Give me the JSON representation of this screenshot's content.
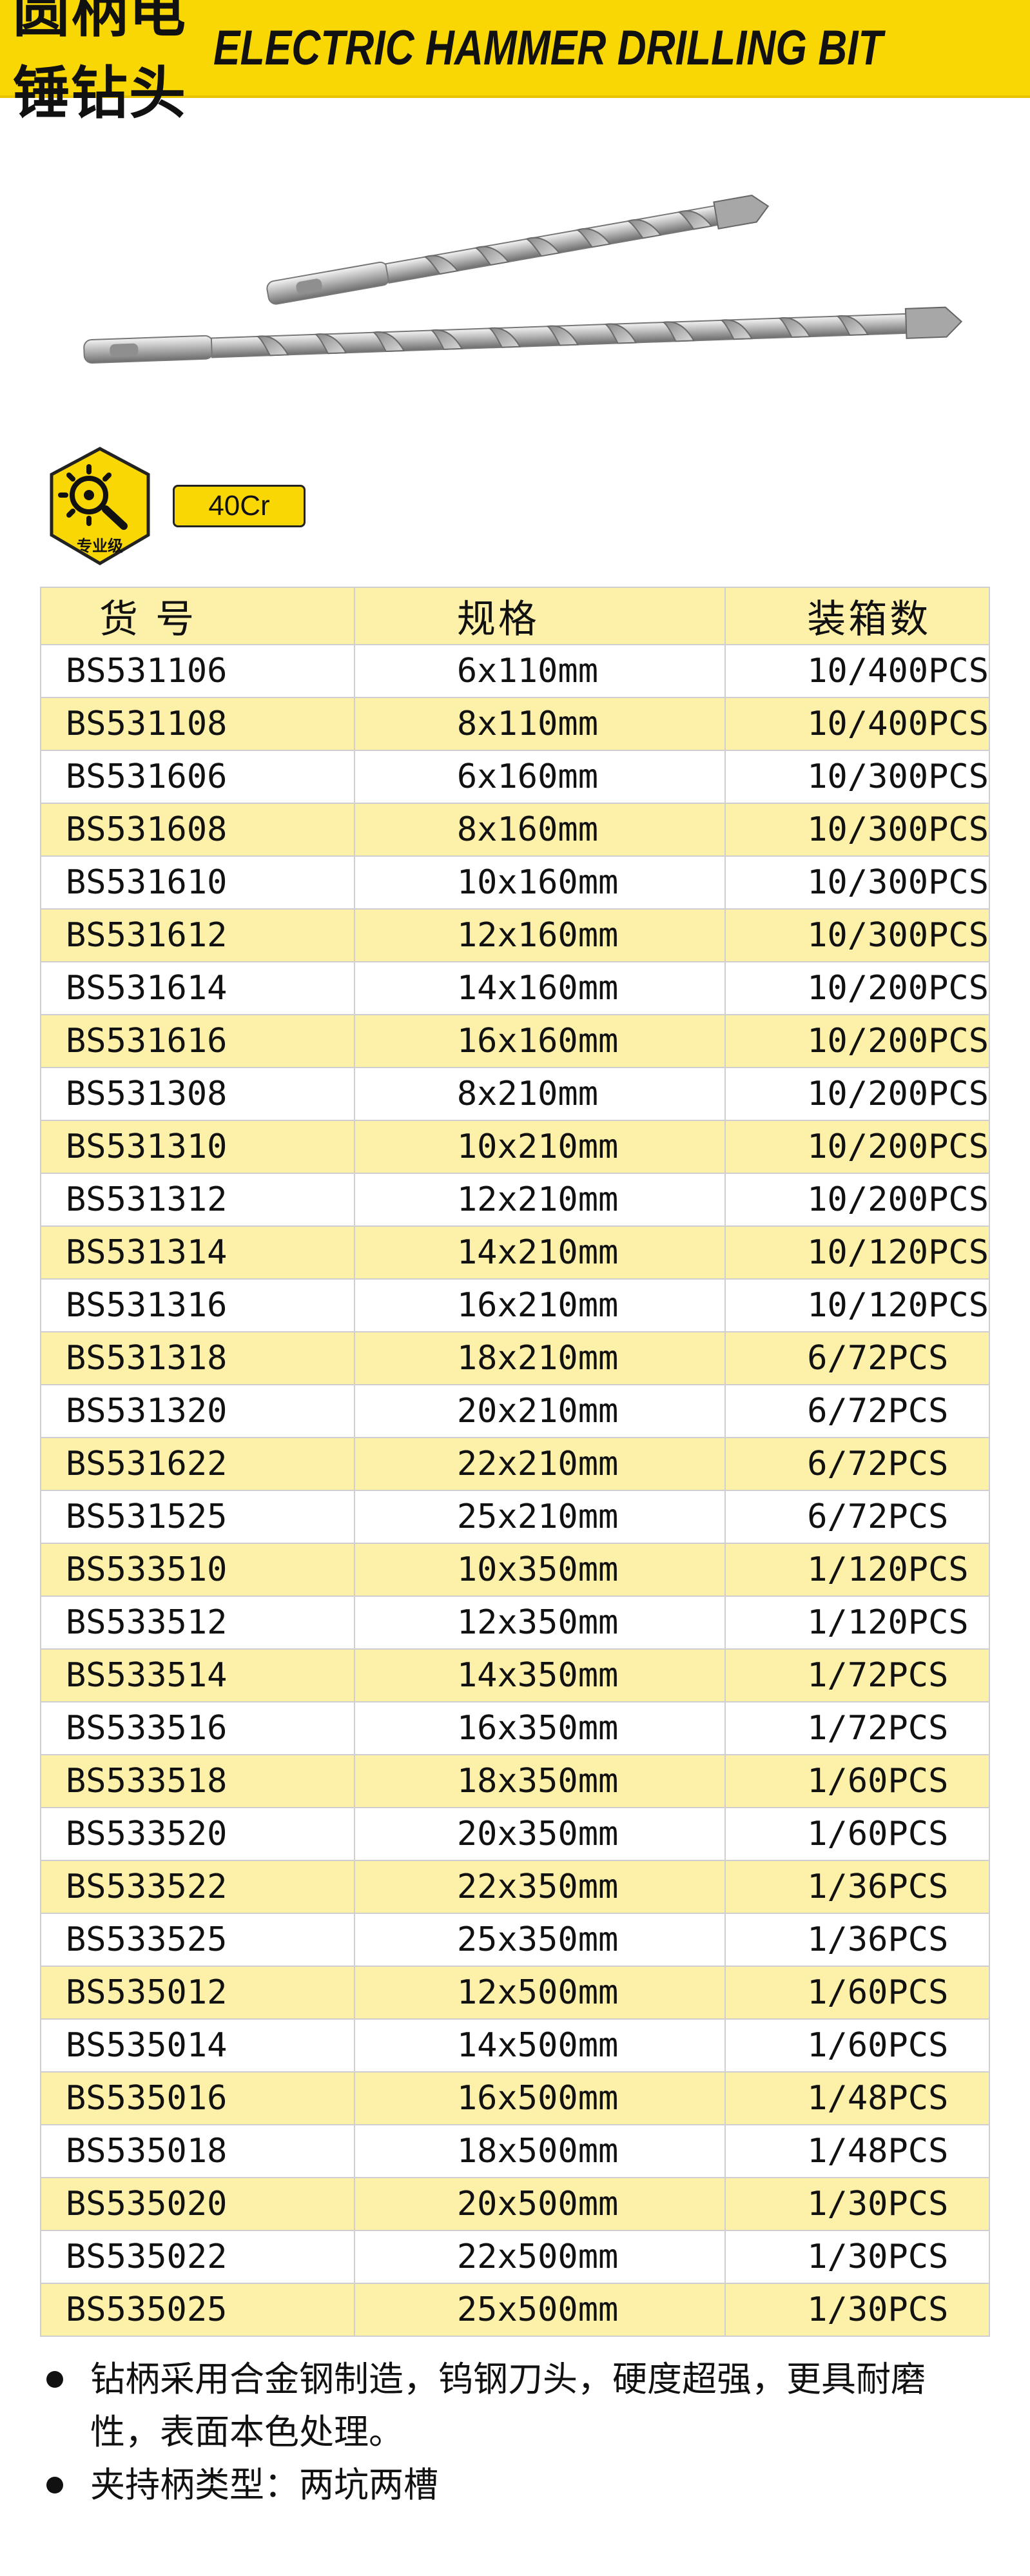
{
  "header": {
    "title_cn": "圆柄电锤钻头",
    "title_en": "ELECTRIC HAMMER DRILLING BIT"
  },
  "badge": {
    "label": "专业级",
    "icon": "professional-grade-icon"
  },
  "material": "40Cr",
  "table": {
    "headers": [
      "货 号",
      "规格",
      "装箱数"
    ],
    "rows": [
      [
        "BS531106",
        "6x110mm",
        "10/400PCS"
      ],
      [
        "BS531108",
        "8x110mm",
        "10/400PCS"
      ],
      [
        "BS531606",
        "6x160mm",
        "10/300PCS"
      ],
      [
        "BS531608",
        "8x160mm",
        "10/300PCS"
      ],
      [
        "BS531610",
        "10x160mm",
        "10/300PCS"
      ],
      [
        "BS531612",
        "12x160mm",
        "10/300PCS"
      ],
      [
        "BS531614",
        "14x160mm",
        "10/200PCS"
      ],
      [
        "BS531616",
        "16x160mm",
        "10/200PCS"
      ],
      [
        "BS531308",
        "8x210mm",
        "10/200PCS"
      ],
      [
        "BS531310",
        "10x210mm",
        "10/200PCS"
      ],
      [
        "BS531312",
        "12x210mm",
        "10/200PCS"
      ],
      [
        "BS531314",
        "14x210mm",
        "10/120PCS"
      ],
      [
        "BS531316",
        "16x210mm",
        "10/120PCS"
      ],
      [
        "BS531318",
        "18x210mm",
        "6/72PCS"
      ],
      [
        "BS531320",
        "20x210mm",
        "6/72PCS"
      ],
      [
        "BS531622",
        "22x210mm",
        "6/72PCS"
      ],
      [
        "BS531525",
        "25x210mm",
        "6/72PCS"
      ],
      [
        "BS533510",
        "10x350mm",
        "1/120PCS"
      ],
      [
        "BS533512",
        "12x350mm",
        "1/120PCS"
      ],
      [
        "BS533514",
        "14x350mm",
        "1/72PCS"
      ],
      [
        "BS533516",
        "16x350mm",
        "1/72PCS"
      ],
      [
        "BS533518",
        "18x350mm",
        "1/60PCS"
      ],
      [
        "BS533520",
        "20x350mm",
        "1/60PCS"
      ],
      [
        "BS533522",
        "22x350mm",
        "1/36PCS"
      ],
      [
        "BS533525",
        "25x350mm",
        "1/36PCS"
      ],
      [
        "BS535012",
        "12x500mm",
        "1/60PCS"
      ],
      [
        "BS535014",
        "14x500mm",
        "1/60PCS"
      ],
      [
        "BS535016",
        "16x500mm",
        "1/48PCS"
      ],
      [
        "BS535018",
        "18x500mm",
        "1/48PCS"
      ],
      [
        "BS535020",
        "20x500mm",
        "1/30PCS"
      ],
      [
        "BS535022",
        "22x500mm",
        "1/30PCS"
      ],
      [
        "BS535025",
        "25x500mm",
        "1/30PCS"
      ]
    ]
  },
  "features": [
    "钻柄采用合金钢制造，钨钢刀头，硬度超强，更具耐磨性，表面本色处理。",
    "夹持柄类型：两坑两槽"
  ]
}
